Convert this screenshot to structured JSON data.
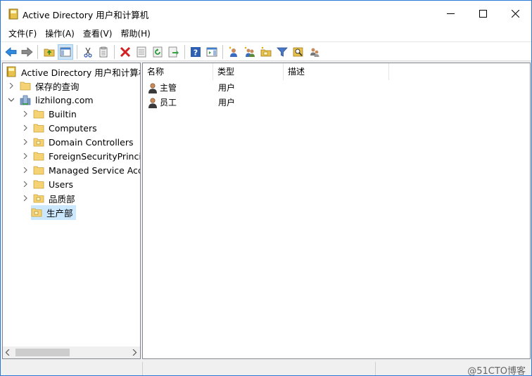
{
  "window": {
    "title": "Active Directory 用户和计算机",
    "icon": "active-directory-book-icon",
    "controls": [
      "minimize-icon",
      "maximize-icon",
      "close-icon"
    ]
  },
  "menu": [
    "文件(F)",
    "操作(A)",
    "查看(V)",
    "帮助(H)"
  ],
  "toolbar": {
    "icons": [
      "back-arrow-icon",
      "forward-arrow-icon",
      "up-folder-icon",
      "show-hide-console-tree-icon",
      "cut-icon",
      "copy-icon",
      "delete-icon",
      "properties-icon",
      "refresh-icon",
      "export-list-icon",
      "help-icon",
      "action-pane-icon",
      "new-user-icon",
      "new-group-icon",
      "new-ou-icon",
      "filter-icon",
      "find-icon",
      "add-to-group-icon"
    ]
  },
  "tree": {
    "root": "Active Directory 用户和计算机",
    "saved_queries": "保存的查询",
    "domain": "lizhilong.com",
    "children": [
      "Builtin",
      "Computers",
      "Domain Controllers",
      "ForeignSecurityPrincipa",
      "Managed Service Acco",
      "Users",
      "品质部",
      "生产部"
    ]
  },
  "list": {
    "columns": [
      "名称",
      "类型",
      "描述"
    ],
    "rows": [
      {
        "name": "主管",
        "type": "用户",
        "desc": ""
      },
      {
        "name": "员工",
        "type": "用户",
        "desc": ""
      }
    ]
  },
  "statusbar": {
    "watermark": "@51CTO博客"
  },
  "colors": {
    "accent_border": "#2b78d8",
    "selection": "#cce8ff",
    "folder": "#f5d274"
  }
}
